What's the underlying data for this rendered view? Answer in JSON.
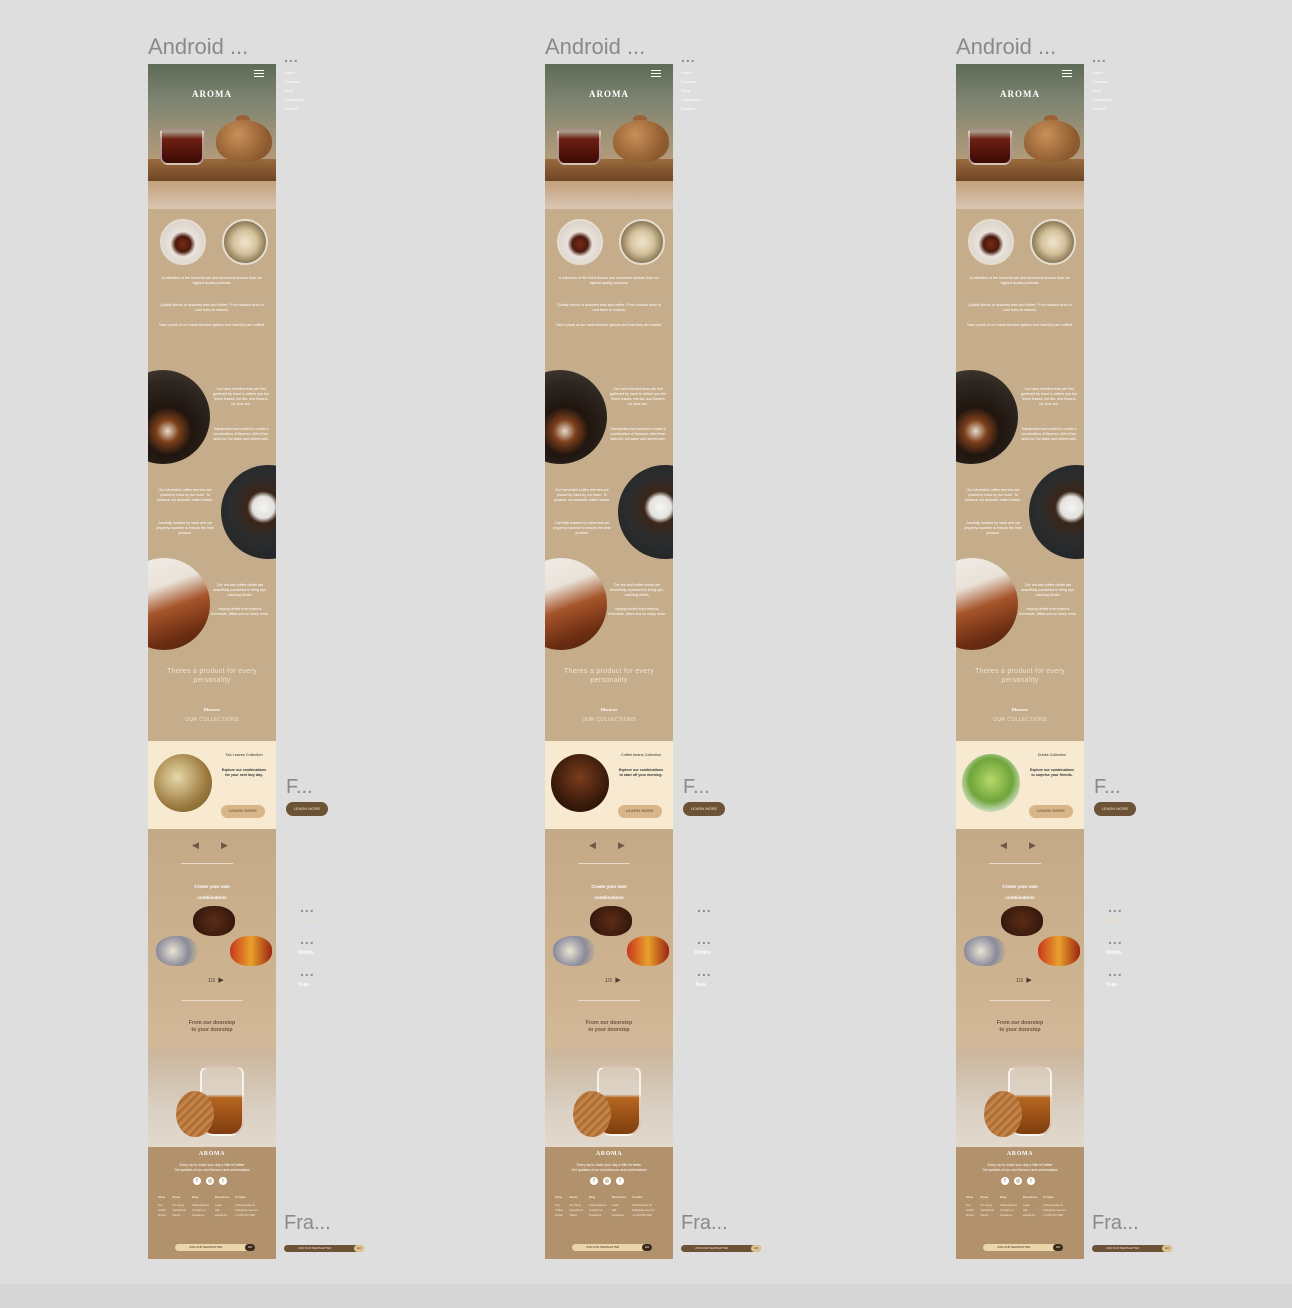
{
  "canvas": {
    "background": "#dedede"
  },
  "frame_label": "Android ...",
  "fra_label": "Fra...",
  "f_label": "F...",
  "dots": "...",
  "logo": "AROMA",
  "nav_items": [
    "Home",
    "Products",
    "Shop",
    "Collections",
    "Contact"
  ],
  "intro": {
    "line1": "A collection of the finest flavors and renowned aromas from our highest quality products.",
    "line2": "Quality blends of assorted teas and coffee. From roasted bean to cold brew to matcha.",
    "line3": "Take a peak at our hand blended options and how they are crafted."
  },
  "features": [
    {
      "text1": "Our hand blended teas are first gathered by hand to deliver you the finest leaves, berries, and flowers for your tea.",
      "text2": "Handpicked and sorted to create a combination of flavours, dried then dried for hot water and stirred well."
    },
    {
      "text1": "Our harvested coffee cherries are picked by hand by our team. To produce our aromatic coffee beans.",
      "text2": "Carefully roasted by hand and our properly machine to ensure the best product."
    },
    {
      "text1": "Our tea and coffee drinks are beautifully combined to bring eye-catching drinks.",
      "text2": "Varying drinks from matcha, lemonade, lattes and so many more."
    }
  ],
  "tagline": "Theres a product for every personality",
  "discover": "Discover",
  "our_collections": "OUR COLLECTIONS",
  "collections": [
    {
      "title": "Tea Leaves Collection",
      "desc": "Explore our combinations for your next lazy day.",
      "button": "LEARN MORE"
    },
    {
      "title": "Coffee beans Collection",
      "desc": "Explore our combinations to start off your morning.",
      "button": "LEARN MORE"
    },
    {
      "title": "Drinks Collection",
      "desc": "Explore our combinations to surprise your friends.",
      "button": "LEARN MORE"
    }
  ],
  "create": {
    "line1": "Create your own",
    "line2": "combinations"
  },
  "pager": "1/3",
  "side_links": [
    "Coffee",
    "Drinks",
    "Teas"
  ],
  "doorstep": {
    "line1": "From our doorstep",
    "line2": "to your doorstep"
  },
  "footer": {
    "logo": "AROMA",
    "sub1": "Every sip to make your day a little bit better",
    "sub2": "Get updates of our new flavours and combinations",
    "columns": [
      {
        "title": "Shop",
        "items": [
          "Tea",
          "Coffee",
          "Drinks"
        ]
      },
      {
        "title": "About",
        "items": [
          "Our Story",
          "Ingredients",
          "Values"
        ]
      },
      {
        "title": "Blog",
        "items": [
          "Subscriptions",
          "Contact us",
          "Locations"
        ]
      },
      {
        "title": "Resources",
        "items": [
          "Learn",
          "Gift",
          "Instagram"
        ]
      },
      {
        "title": "Contact",
        "items": [
          "123 Example St",
          "hello@aroma.com",
          "+1 234 567 890"
        ]
      }
    ],
    "newsletter": "JOIN OUR NEWSLETTER",
    "go": "GO"
  },
  "colors": {
    "brown": "#c5ad8b",
    "cream": "#f7ead1",
    "accent": "#d9b689",
    "dark_button": "#6c5337"
  }
}
